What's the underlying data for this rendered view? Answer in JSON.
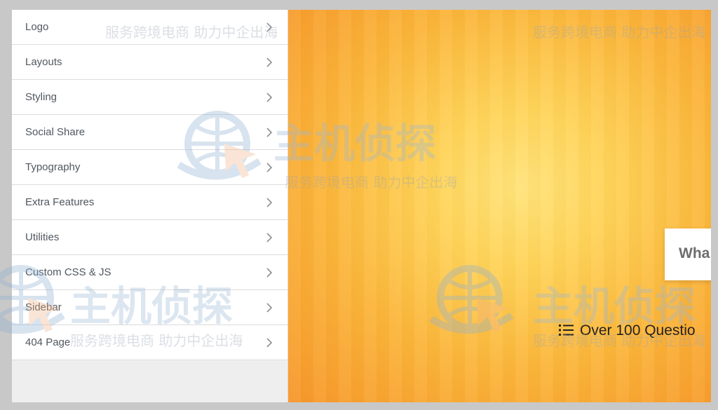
{
  "menu": {
    "items": [
      {
        "label": "Logo"
      },
      {
        "label": "Layouts"
      },
      {
        "label": "Styling"
      },
      {
        "label": "Social Share"
      },
      {
        "label": "Typography"
      },
      {
        "label": "Extra Features"
      },
      {
        "label": "Utilities"
      },
      {
        "label": "Custom CSS & JS"
      },
      {
        "label": "Sidebar"
      },
      {
        "label": "404 Page"
      }
    ]
  },
  "preview": {
    "search_text": "Wha",
    "stat_text": "Over 100 Questio",
    "stat_icon": "list-icon",
    "colors": {
      "gradient_light": "#ffe37a",
      "gradient_dark": "#f7962a"
    }
  },
  "watermark": {
    "logo_text": "主机侦探",
    "sub_text": "服务跨境电商 助力中企出海",
    "icon": "globe-cursor-icon"
  }
}
